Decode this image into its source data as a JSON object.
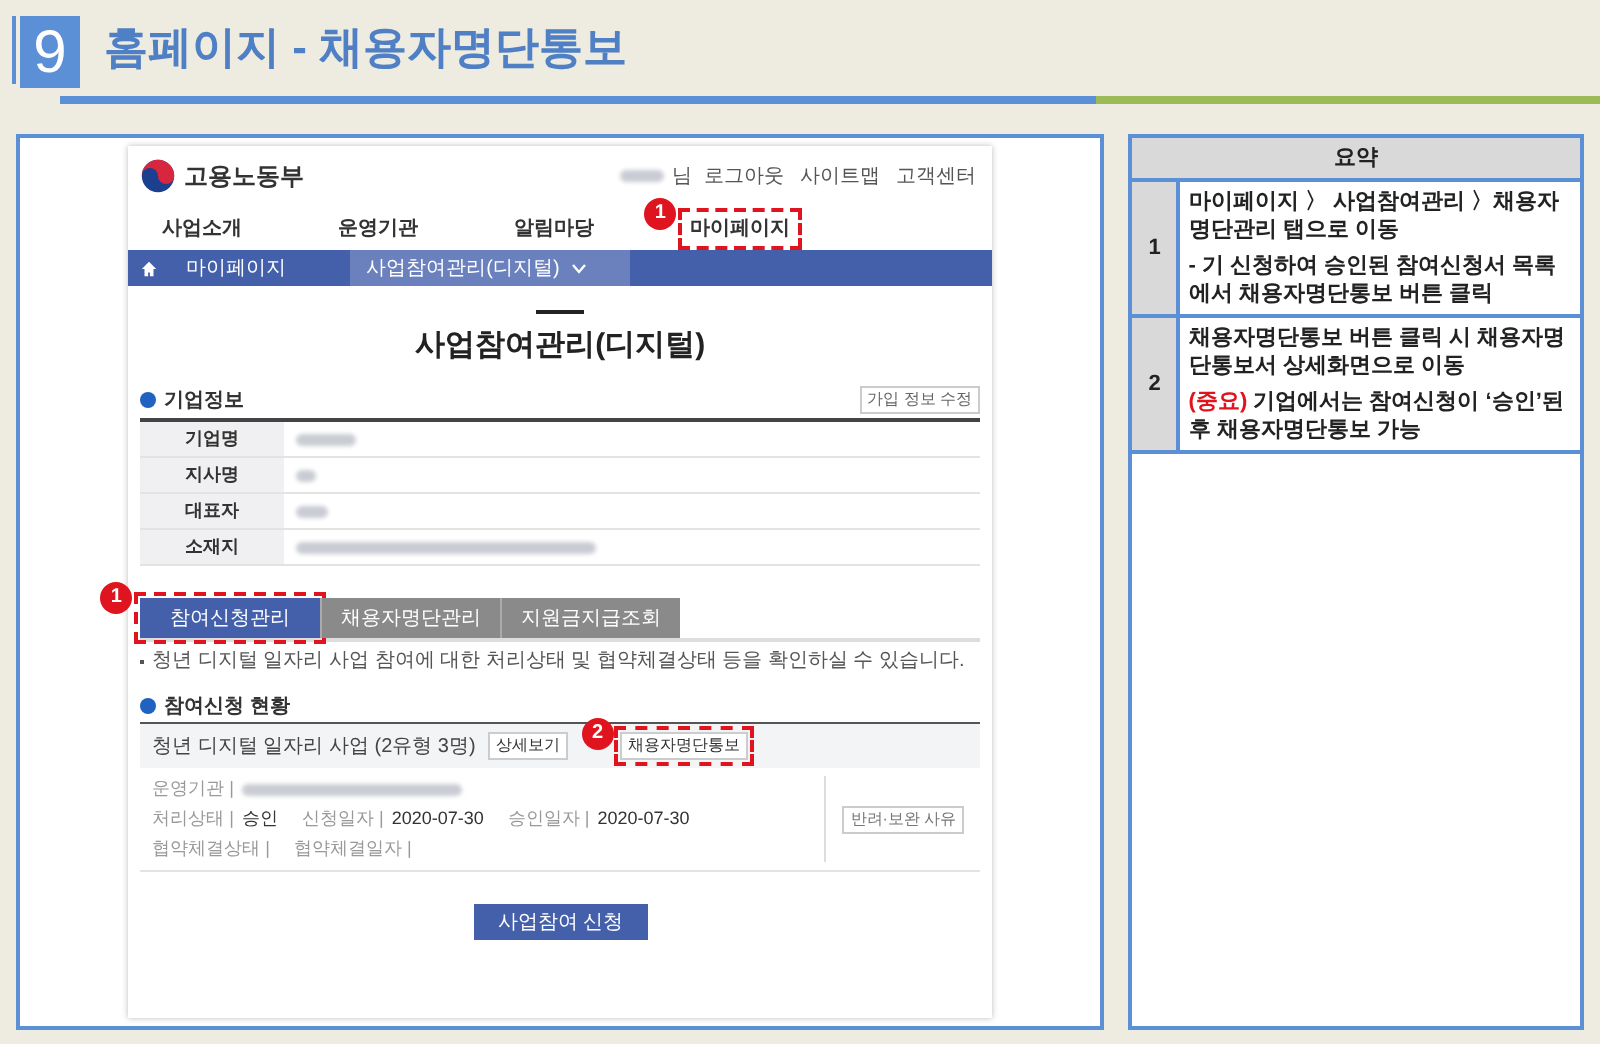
{
  "header": {
    "number": "9",
    "title": "홈페이지 - 채용자명단통보"
  },
  "site": {
    "logo": "고용노동부",
    "user_suffix": "님",
    "user_redacted": true,
    "links": [
      "로그아웃",
      "사이트맵",
      "고객센터"
    ],
    "nav": [
      {
        "label": "사업소개"
      },
      {
        "label": "운영기관"
      },
      {
        "label": "알림마당"
      },
      {
        "label": "마이페이지",
        "callout": "1"
      }
    ],
    "breadcrumb": [
      {
        "label": "마이페이지"
      },
      {
        "label": "사업참여관리(디지털)",
        "dropdown": true
      }
    ],
    "page_title": "사업참여관리(디지털)",
    "company": {
      "heading": "기업정보",
      "edit_button": "가입 정보 수정",
      "rows": [
        {
          "label": "기업명",
          "redacted": true
        },
        {
          "label": "지사명",
          "redacted": true
        },
        {
          "label": "대표자",
          "redacted": true
        },
        {
          "label": "소재지",
          "redacted": true
        }
      ]
    },
    "tabs": [
      {
        "label": "참여신청관리",
        "selected": true,
        "callout": "1"
      },
      {
        "label": "채용자명단관리",
        "selected": false
      },
      {
        "label": "지원금지급조회",
        "selected": false
      }
    ],
    "note": "청년 디지털 일자리 사업 참여에 대한 처리상태 및 협약체결상태 등을 확인하실 수 있습니다.",
    "applications": {
      "heading": "참여신청 현황",
      "card_title": "청년 디지털 일자리 사업 (2유형 3명)",
      "buttons": [
        {
          "label": "상세보기"
        },
        {
          "label": "채용자명단통보",
          "callout": "2"
        }
      ],
      "fields": [
        [
          {
            "label": "운영기관 |",
            "redacted": true
          }
        ],
        [
          {
            "label": "처리상태 |",
            "value": "승인"
          },
          {
            "label": "신청일자 |",
            "value": "2020-07-30"
          },
          {
            "label": "승인일자 |",
            "value": "2020-07-30"
          }
        ],
        [
          {
            "label": "협약체결상태 |"
          },
          {
            "label": "협약체결일자 |"
          }
        ]
      ],
      "side_button": "반려·보완 사유",
      "submit": "사업참여 신청"
    }
  },
  "summary": {
    "heading": "요약",
    "rows": [
      {
        "number": "1",
        "paragraphs": [
          {
            "text": "마이페이지 〉 사업참여관리 〉채용자명단관리 탭으로 이동"
          },
          {
            "text": "- 기 신청하여 승인된 참여신청서 목록에서 채용자명단통보 버튼 클릭"
          }
        ]
      },
      {
        "number": "2",
        "paragraphs": [
          {
            "text": "채용자명단통보 버튼 클릭 시 채용자명단통보서 상세화면으로 이동"
          },
          {
            "emphasis": "(중요)",
            "text": " 기업에서는 참여신청이 ‘승인’된 후 채용자명단통보 가능"
          }
        ]
      }
    ]
  }
}
